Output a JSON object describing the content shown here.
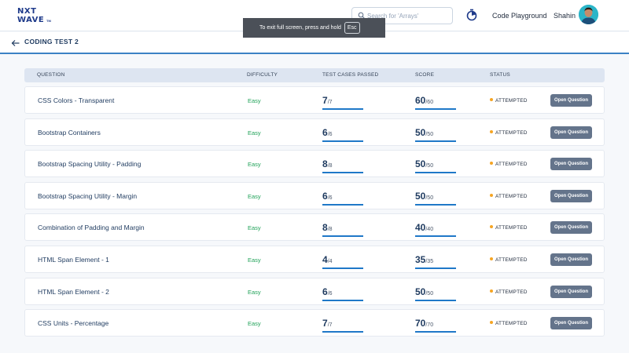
{
  "brand": {
    "line1": "NXT",
    "line2": "WAVE",
    "tm": "TM"
  },
  "search": {
    "placeholder": "Search for 'Arrays'",
    "value": ""
  },
  "header": {
    "playground": "Code Playground",
    "username": "Shahin"
  },
  "toast": {
    "message": "To exit full screen, press and hold",
    "key": "Esc"
  },
  "page": {
    "title": "CODING TEST 2"
  },
  "table": {
    "headers": {
      "question": "QUESTION",
      "difficulty": "DIFFICULTY",
      "tests": "TEST CASES PASSED",
      "score": "SCORE",
      "status": "STATUS"
    },
    "rows": [
      {
        "question": "CSS Colors - Transparent",
        "difficulty": "Easy",
        "passed": "7",
        "total": "/7",
        "score": "60",
        "max": "/60",
        "status": "ATTEMPTED",
        "action": "Open Question",
        "progress": 1.0
      },
      {
        "question": "Bootstrap Containers",
        "difficulty": "Easy",
        "passed": "6",
        "total": "/6",
        "score": "50",
        "max": "/50",
        "status": "ATTEMPTED",
        "action": "Open Question",
        "progress": 1.0
      },
      {
        "question": "Bootstrap Spacing Utility - Padding",
        "difficulty": "Easy",
        "passed": "8",
        "total": "/8",
        "score": "50",
        "max": "/50",
        "status": "ATTEMPTED",
        "action": "Open Question",
        "progress": 1.0
      },
      {
        "question": "Bootstrap Spacing Utility - Margin",
        "difficulty": "Easy",
        "passed": "6",
        "total": "/6",
        "score": "50",
        "max": "/50",
        "status": "ATTEMPTED",
        "action": "Open Question",
        "progress": 1.0
      },
      {
        "question": "Combination of Padding and Margin",
        "difficulty": "Easy",
        "passed": "8",
        "total": "/8",
        "score": "40",
        "max": "/40",
        "status": "ATTEMPTED",
        "action": "Open Question",
        "progress": 1.0
      },
      {
        "question": "HTML Span Element - 1",
        "difficulty": "Easy",
        "passed": "4",
        "total": "/4",
        "score": "35",
        "max": "/35",
        "status": "ATTEMPTED",
        "action": "Open Question",
        "progress": 1.0
      },
      {
        "question": "HTML Span Element - 2",
        "difficulty": "Easy",
        "passed": "6",
        "total": "/6",
        "score": "50",
        "max": "/50",
        "status": "ATTEMPTED",
        "action": "Open Question",
        "progress": 1.0
      },
      {
        "question": "CSS Units - Percentage",
        "difficulty": "Easy",
        "passed": "7",
        "total": "/7",
        "score": "70",
        "max": "/70",
        "status": "ATTEMPTED",
        "action": "Open Question",
        "progress": 1.0
      }
    ]
  },
  "icons": {
    "back": "arrow-left-icon",
    "search": "search-icon",
    "timer": "timer-icon"
  },
  "colors": {
    "accent": "#1f78c8",
    "easy": "#22a35a",
    "attempted_dot": "#f5a524",
    "button": "#64748b",
    "title": "#1e3a5f"
  }
}
